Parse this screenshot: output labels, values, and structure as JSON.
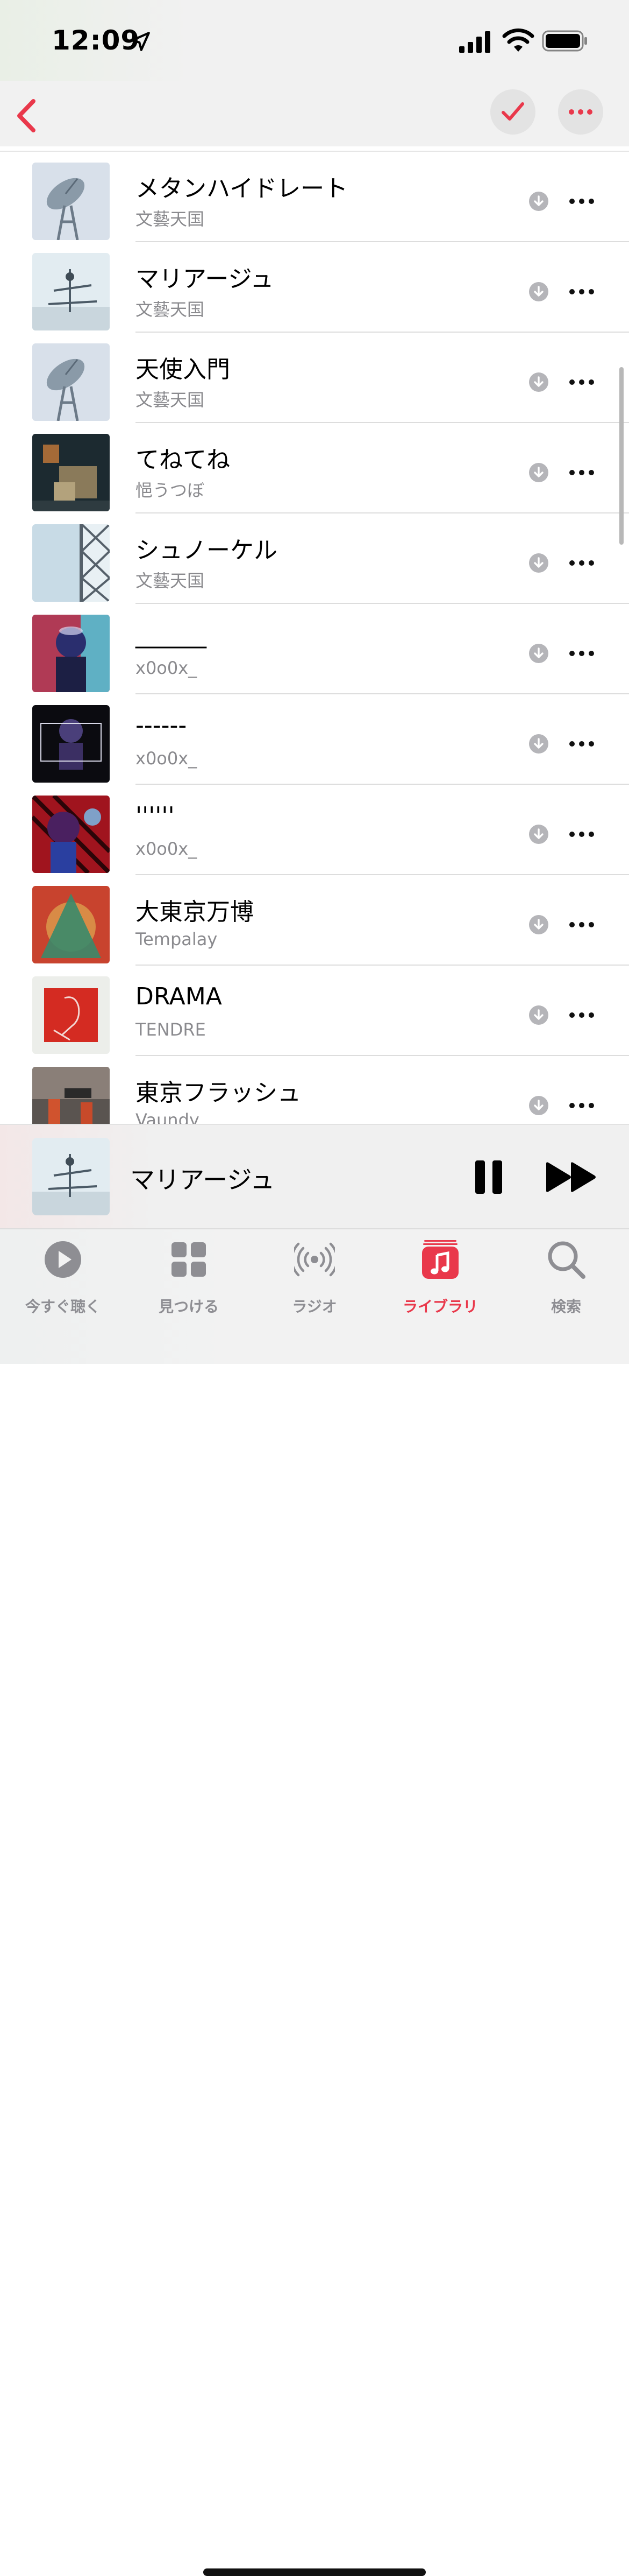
{
  "status_bar": {
    "time": "12:09"
  },
  "colors": {
    "accent": "#e9384b",
    "secondary_text": "#8a8a8e",
    "tab_inactive": "#8e8e93"
  },
  "nav": {
    "back_icon": "chevron-left-icon",
    "select_icon": "checkmark-icon",
    "more_icon": "ellipsis-icon"
  },
  "songs": [
    {
      "title": "メタンハイドレート",
      "artist": "文藝天国"
    },
    {
      "title": "マリアージュ",
      "artist": "文藝天国"
    },
    {
      "title": "天使入門",
      "artist": "文藝天国"
    },
    {
      "title": "てねてね",
      "artist": "悒うつぼ"
    },
    {
      "title": "シュノーケル",
      "artist": "文藝天国"
    },
    {
      "title": "______",
      "artist": "x0o0x_"
    },
    {
      "title": "------",
      "artist": "x0o0x_"
    },
    {
      "title": "''''''",
      "artist": "x0o0x_"
    },
    {
      "title": "大東京万博",
      "artist": "Tempalay"
    },
    {
      "title": "DRAMA",
      "artist": "TENDRE"
    },
    {
      "title": "東京フラッシュ",
      "artist": "Vaundy"
    }
  ],
  "mini_player": {
    "title": "マリアージュ",
    "playing": true
  },
  "tabs": [
    {
      "label": "今すぐ聴く",
      "icon": "play-circle-icon",
      "active": false
    },
    {
      "label": "見つける",
      "icon": "grid-icon",
      "active": false
    },
    {
      "label": "ラジオ",
      "icon": "radio-icon",
      "active": false
    },
    {
      "label": "ライブラリ",
      "icon": "music-note-icon",
      "active": true
    },
    {
      "label": "検索",
      "icon": "search-icon",
      "active": false
    }
  ]
}
